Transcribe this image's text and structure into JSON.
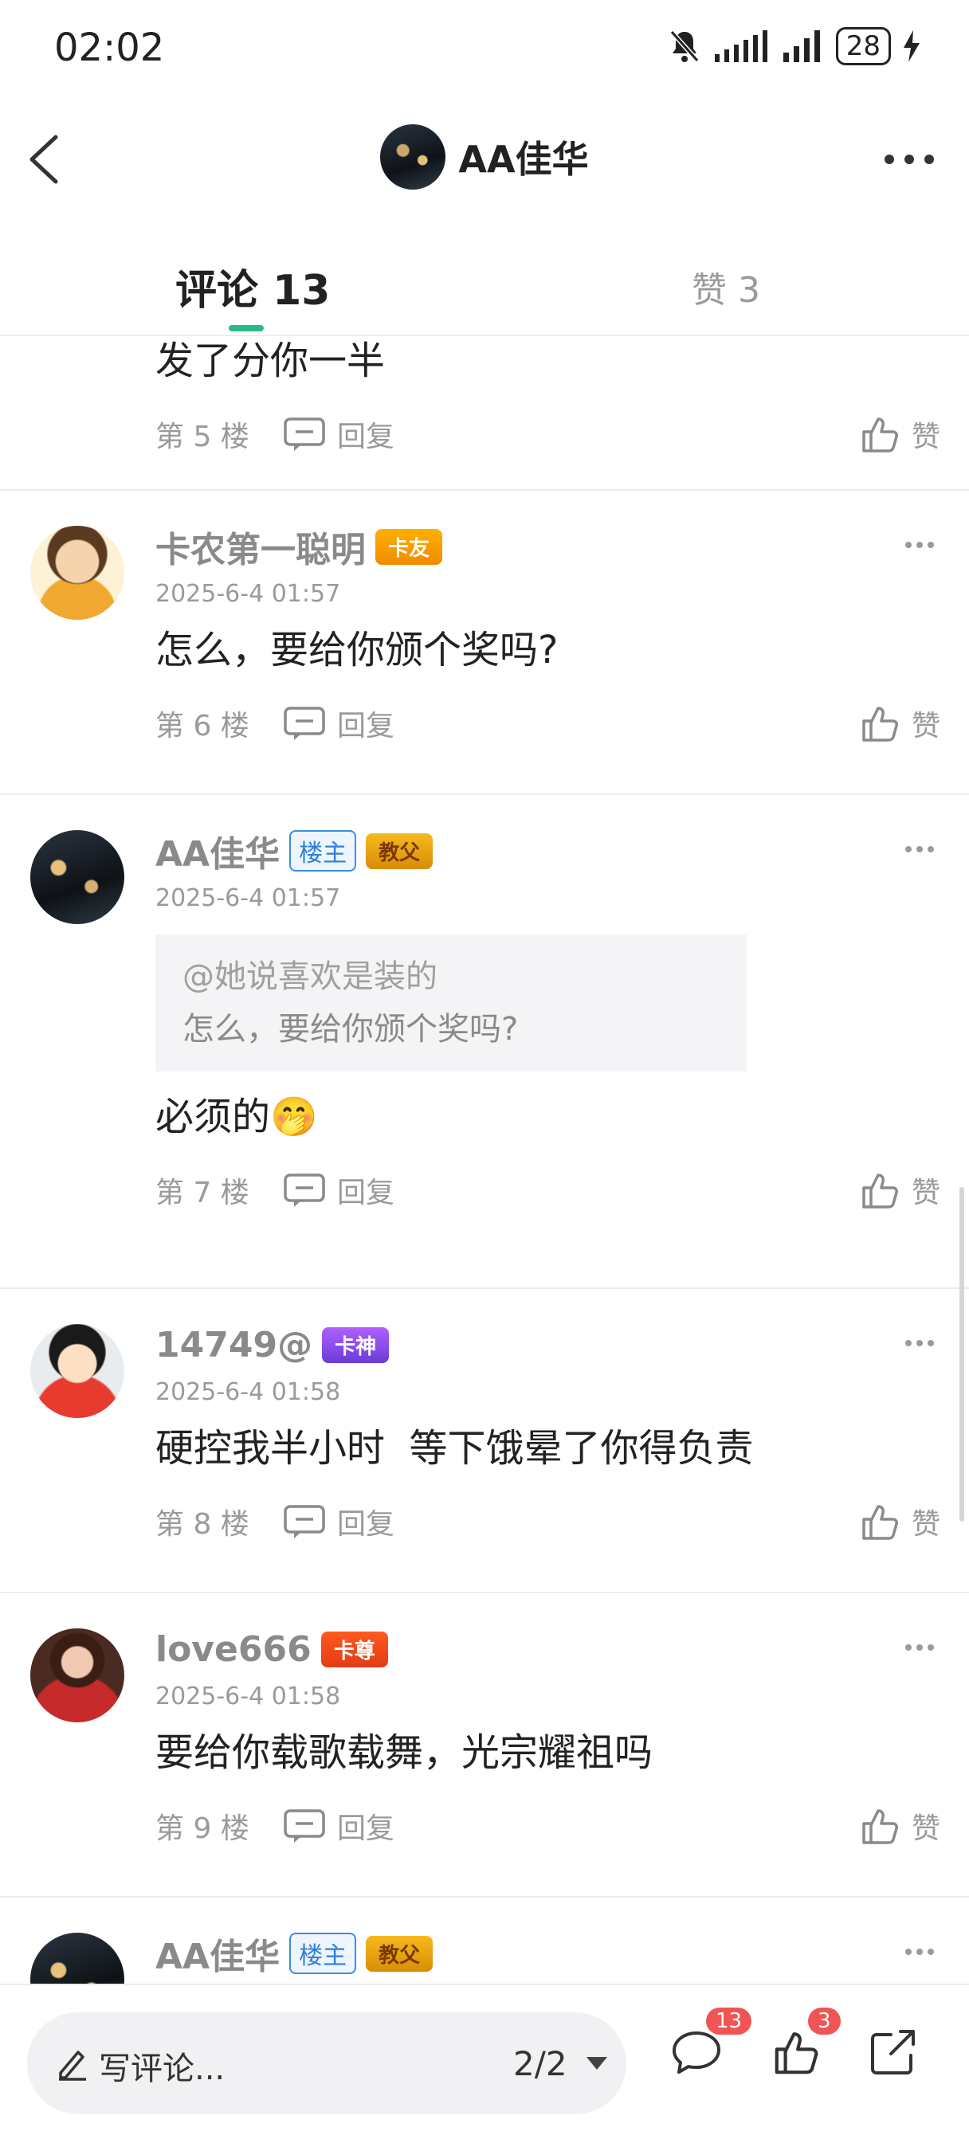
{
  "status": {
    "time": "02:02",
    "battery": "28"
  },
  "header": {
    "title": "AA佳华"
  },
  "tabs": {
    "comments": "评论 13",
    "likes": "赞 3"
  },
  "top_partial": {
    "text": "发了分你一半",
    "floor": "第 5 楼",
    "reply": "回复",
    "like": "赞"
  },
  "comments": [
    {
      "name": "卡农第一聪明",
      "badge": "卡友",
      "time": "2025-6-4 01:57",
      "text": "怎么，要给你颁个奖吗?",
      "floor": "第 6 楼",
      "reply": "回复",
      "like": "赞"
    },
    {
      "name": "AA佳华",
      "owner": "楼主",
      "badge": "教父",
      "time": "2025-6-4 01:57",
      "quote_user": "@她说喜欢是装的",
      "quote_text": "怎么，要给你颁个奖吗?",
      "text": "必须的",
      "emoji": "🤭",
      "floor": "第 7 楼",
      "reply": "回复",
      "like": "赞"
    },
    {
      "name": "14749@",
      "badge": "卡神",
      "time": "2025-6-4 01:58",
      "text": "硬控我半小时  等下饿晕了你得负责",
      "floor": "第 8 楼",
      "reply": "回复",
      "like": "赞"
    },
    {
      "name": "love666",
      "badge": "卡尊",
      "time": "2025-6-4 01:58",
      "text": "要给你载歌载舞，光宗耀祖吗",
      "floor": "第 9 楼",
      "reply": "回复",
      "like": "赞"
    },
    {
      "name": "AA佳华",
      "owner": "楼主",
      "badge": "教父"
    }
  ],
  "bottom": {
    "write": "写评论...",
    "page": "2/2",
    "comment_count": "13",
    "like_count": "3"
  },
  "colors": {
    "accent": "#2bb888",
    "badge_red": "#f05454",
    "owner_blue": "#2f7fd6"
  }
}
